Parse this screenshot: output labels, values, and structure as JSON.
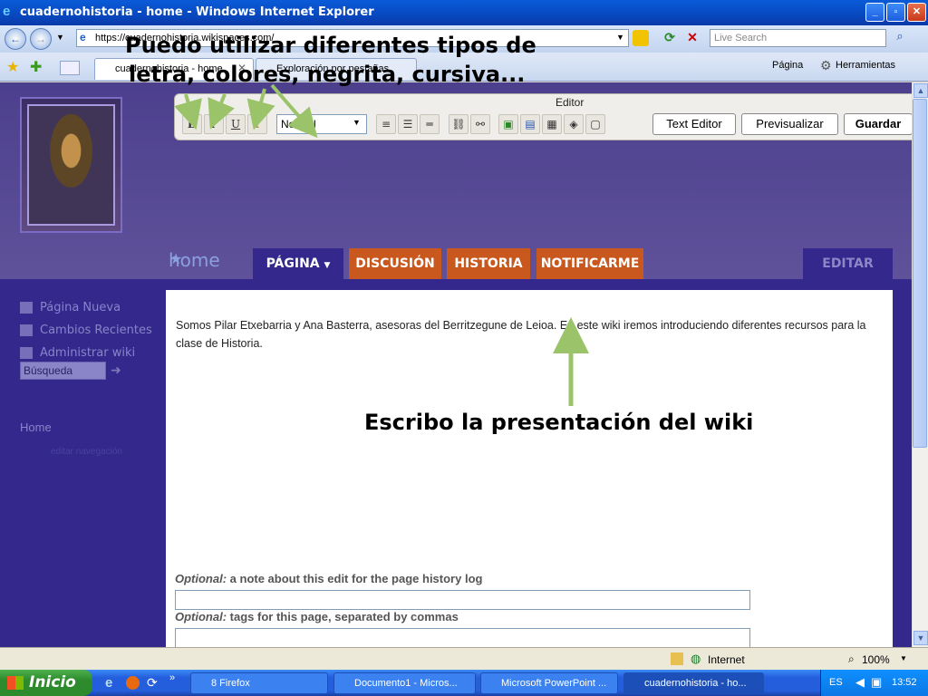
{
  "window": {
    "title": "cuadernohistoria - home - Windows Internet Explorer",
    "minimize": "_",
    "maximize": "▫",
    "close": "✕"
  },
  "address": {
    "url": "https://cuadernohistoria.wikispaces.com/"
  },
  "search": {
    "placeholder": "Live Search"
  },
  "tabs": [
    {
      "label": "cuadernohistoria - home"
    },
    {
      "label": "Exploración por pestañas"
    }
  ],
  "toolbar_right": {
    "pagina": "Página",
    "herramientas": "Herramientas"
  },
  "editor": {
    "label": "Editor",
    "bold": "B",
    "italic": "I",
    "underline": "U",
    "color": "T",
    "format_value": "Normal",
    "text_editor": "Text Editor",
    "preview": "Previsualizar",
    "save": "Guardar"
  },
  "wiki": {
    "page_title": "home",
    "tabs": {
      "pagina": "PÁGINA",
      "discusion": "DISCUSIÓN",
      "historia": "HISTORIA",
      "notificarme": "NOTIFICARME",
      "editar": "EDITAR"
    },
    "sidebar": {
      "items": [
        {
          "label": "Página Nueva"
        },
        {
          "label": "Cambios Recientes"
        },
        {
          "label": "Administrar wiki"
        }
      ],
      "search_value": "Búsqueda",
      "home": "Home",
      "edit_nav": "editar navegación"
    },
    "intro_text": "Somos Pilar Etxebarria y Ana Basterra, asesoras del Berritzegune de Leioa. En este wiki iremos introduciendo diferentes recursos para la clase de Historia.",
    "optional_prefix": "Optional:",
    "note_label": " a note about this edit for the page history log",
    "tags_label": " tags for this page, separated by commas"
  },
  "annotations": {
    "top_line1": "Puedo utilizar diferentes tipos de",
    "top_line2": "letra, colores, negrita, cursiva...",
    "middle": "Escribo la presentación del wiki"
  },
  "statusbar": {
    "zone": "Internet",
    "zoom": "100%"
  },
  "taskbar": {
    "start": "Inicio",
    "buttons": [
      {
        "label": "8 Firefox"
      },
      {
        "label": "Documento1 - Micros..."
      },
      {
        "label": "Microsoft PowerPoint ..."
      },
      {
        "label": "cuadernohistoria - ho..."
      }
    ],
    "lang": "ES",
    "time": "13:52"
  },
  "colors": {
    "wiki_navy": "#34288c",
    "wiki_orange": "#c8581e",
    "annotation_arrow": "#9bc46a"
  }
}
